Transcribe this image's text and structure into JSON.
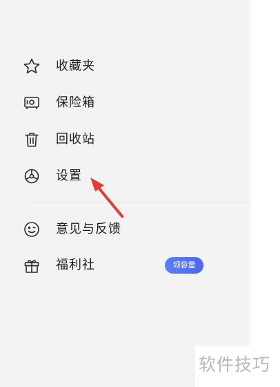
{
  "menu": {
    "items": [
      {
        "label": "收藏夹",
        "icon": "star-icon"
      },
      {
        "label": "保险箱",
        "icon": "safe-icon"
      },
      {
        "label": "回收站",
        "icon": "trash-icon"
      },
      {
        "label": "设置",
        "icon": "settings-icon"
      },
      {
        "label": "意见与反馈",
        "icon": "smile-face-icon"
      },
      {
        "label": "福利社",
        "icon": "gift-icon"
      }
    ],
    "welfare_badge": "领容量"
  },
  "annotation": {
    "arrow_color": "#e53935",
    "points_to": "设置"
  },
  "watermark": "软件技巧",
  "colors": {
    "drawer_background": "#f3f3f4",
    "badge": "#5470f5",
    "text": "#1e1e1e"
  }
}
